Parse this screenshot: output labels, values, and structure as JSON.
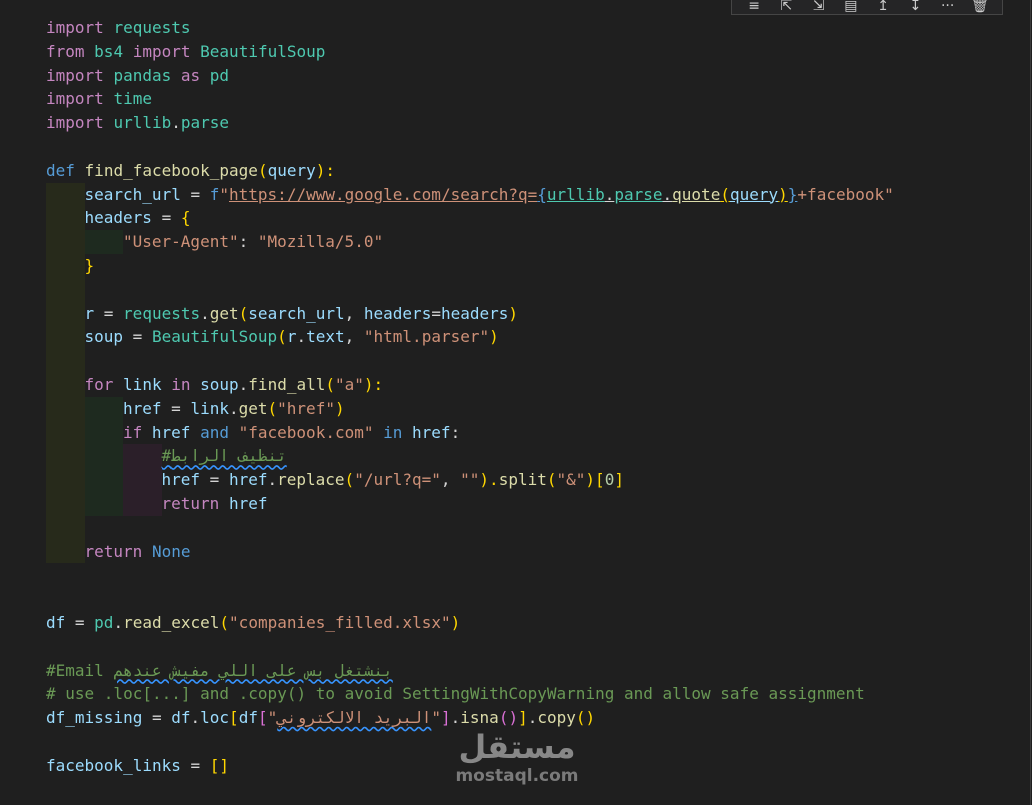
{
  "toolbar": {
    "icons": [
      "format-icon",
      "run-above-icon",
      "run-below-icon",
      "split-cell-icon",
      "insert-above-icon",
      "insert-below-icon",
      "more-icon",
      "delete-icon"
    ],
    "glyphs": [
      "≡",
      "⇱",
      "⇲",
      "▤",
      "↥",
      "↧",
      "···",
      "🗑"
    ]
  },
  "code": {
    "line1": [
      "import",
      " ",
      "requests"
    ],
    "line2": [
      "from",
      " ",
      "bs4",
      " ",
      "import",
      " ",
      "BeautifulSoup"
    ],
    "line3": [
      "import",
      " ",
      "pandas",
      " ",
      "as",
      " ",
      "pd"
    ],
    "line4": [
      "import",
      " ",
      "time"
    ],
    "line5": [
      "import",
      " ",
      "urllib",
      ".",
      "parse"
    ],
    "line7": [
      "def",
      " ",
      "find_facebook_page",
      "(",
      "query",
      "):"
    ],
    "line8": [
      "search_url",
      " = ",
      "f",
      "\"",
      "https://www.google.com/search?q=",
      "{",
      "urllib",
      ".",
      "parse",
      ".",
      "quote",
      "(",
      "query",
      ")",
      "}",
      "+facebook\""
    ],
    "line9": [
      "headers",
      " = ",
      "{"
    ],
    "line10": [
      "\"User-Agent\"",
      ": ",
      "\"Mozilla/5.0\""
    ],
    "line11": [
      "}"
    ],
    "line13": [
      "r",
      " = ",
      "requests",
      ".",
      "get",
      "(",
      "search_url",
      ", ",
      "headers",
      "=",
      "headers",
      ")"
    ],
    "line14": [
      "soup",
      " = ",
      "BeautifulSoup",
      "(",
      "r",
      ".",
      "text",
      ", ",
      "\"html.parser\"",
      ")"
    ],
    "line16": [
      "for",
      " ",
      "link",
      " ",
      "in",
      " ",
      "soup",
      ".",
      "find_all",
      "(",
      "\"a\"",
      "):"
    ],
    "line17": [
      "href",
      " = ",
      "link",
      ".",
      "get",
      "(",
      "\"href\"",
      ")"
    ],
    "line18": [
      "if",
      " ",
      "href",
      " ",
      "and",
      " ",
      "\"facebook.com\"",
      " ",
      "in",
      " ",
      "href",
      ":"
    ],
    "line19": [
      "#تنظيف الرابط"
    ],
    "line20": [
      "href",
      " = ",
      "href",
      ".",
      "replace",
      "(",
      "\"/url?q=\"",
      ", ",
      "\"\"",
      ").",
      "split",
      "(",
      "\"&\"",
      ")",
      "[",
      "0",
      "]"
    ],
    "line21": [
      "return",
      " ",
      "href"
    ],
    "line23": [
      "return",
      " ",
      "None"
    ],
    "line26": [
      "df",
      " = ",
      "pd",
      ".",
      "read_excel",
      "(",
      "\"companies_filled.xlsx\"",
      ")"
    ],
    "line28": [
      "#Email",
      " ",
      "بنشتغل بس على اللي مفيش عندهم"
    ],
    "line29": [
      "# use .loc[...] and .copy() to avoid SettingWithCopyWarning and allow safe assignment"
    ],
    "line30": [
      "df_missing",
      " = ",
      "df",
      ".",
      "loc",
      "[",
      "df",
      "[",
      "\"",
      "البريد الالكتروني",
      "\"",
      "]",
      ".",
      "isna",
      "()",
      "]",
      ".",
      "copy",
      "()"
    ],
    "line32": [
      "facebook_links",
      " = ",
      "[]"
    ]
  },
  "watermark": {
    "arabic": "مستقل",
    "latin": "mostaql.com"
  }
}
